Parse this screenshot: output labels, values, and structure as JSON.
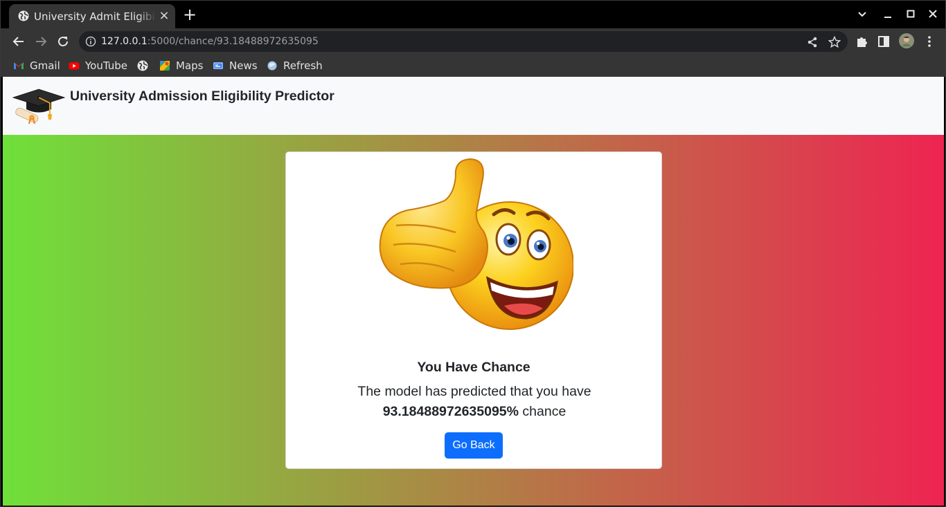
{
  "browser": {
    "tab_title": "University Admit Eligibility Predictor",
    "tab_close_glyph": "×",
    "new_tab_glyph": "+",
    "url_host": "127.0.0.1",
    "url_rest": ":5000/chance/93.18488972635095",
    "bookmarks": [
      {
        "label": "Gmail",
        "icon": "gmail-icon"
      },
      {
        "label": "YouTube",
        "icon": "youtube-icon"
      },
      {
        "label": "",
        "icon": "globe-icon"
      },
      {
        "label": "Maps",
        "icon": "maps-icon"
      },
      {
        "label": "News",
        "icon": "news-icon"
      },
      {
        "label": "Refresh",
        "icon": "refresh-bookmark-icon"
      }
    ],
    "colors": {
      "frame": "#000000",
      "toolbar": "#353535",
      "omnibox": "#202124"
    }
  },
  "page": {
    "brand": "University Admission Eligibility Predictor",
    "result": {
      "title": "You Have Chance",
      "text_prefix": "The model has predicted that you have",
      "chance": "93.18488972635095%",
      "text_suffix": "chance",
      "button": "Go Back"
    },
    "colors": {
      "gradient_start": "#6fe03a",
      "gradient_end": "#ee2451",
      "button": "#0d6efd",
      "navbar": "#f8f9fa"
    }
  }
}
